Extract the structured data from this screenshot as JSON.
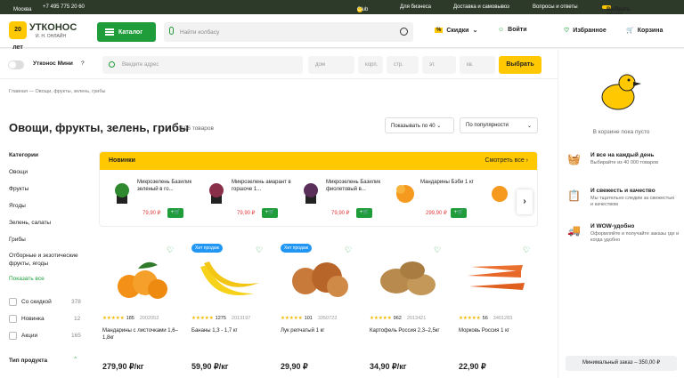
{
  "topbar": {
    "city": "Москва",
    "phone": "+7 495 775 20 60",
    "club": "Club",
    "business": "Для бизнеса",
    "delivery": "Доставка и самовывоз",
    "faq": "Вопросы и ответы",
    "choose_time": "Выбрать время"
  },
  "header": {
    "logo": "УТКОНОС",
    "logo_sub": "И. Н. ОНЛАЙН",
    "logo_badge": "20 лет",
    "catalog": "Каталог",
    "search_placeholder": "Найти колбасу",
    "discounts": "Скидки",
    "login": "Войти",
    "favorites": "Избранное",
    "cart": "Корзина"
  },
  "address": {
    "mini": "Утконос Мини",
    "help": "?",
    "placeholder": "Введите адрес",
    "house": "дом",
    "korp": "корп.",
    "str": "стр.",
    "floor": "эт.",
    "apt": "кв.",
    "choose": "Выбрать"
  },
  "breadcrumb": {
    "home": "Главная",
    "sep": "—",
    "current": "Овощи, фрукты, зелень, грибы"
  },
  "page": {
    "title": "Овощи, фрукты, зелень, грибы",
    "count": "1196 товаров",
    "show": "Показывать по 40",
    "sort": "По популярности"
  },
  "sidebar": {
    "categories_title": "Категории",
    "items": [
      "Овощи",
      "Фрукты",
      "Ягоды",
      "Зелень, салаты",
      "Грибы",
      "Отборные и экзотические фрукты, ягоды"
    ],
    "show_all": "Показать все",
    "filters": [
      {
        "label": "Со скидкой",
        "count": "378"
      },
      {
        "label": "Новинка",
        "count": "12"
      },
      {
        "label": "Акции",
        "count": "165"
      }
    ],
    "type_title": "Тип продукта"
  },
  "novelties": {
    "title": "Новинки",
    "see_all": "Смотреть все",
    "items": [
      {
        "name": "Микрозелень Базилик зеленый в го...",
        "price": "79,90 ₽"
      },
      {
        "name": "Микрозелень амарант в горшоче 1...",
        "price": "79,90 ₽"
      },
      {
        "name": "Микрозелень Базилик фиолетовый в...",
        "price": "79,90 ₽"
      },
      {
        "name": "Мандарины Бэби 1 кг",
        "price": "299,90 ₽"
      }
    ]
  },
  "products": [
    {
      "name": "Мандарины с листочками 1,6–1,8кг",
      "reviews": "185",
      "code": "2002053",
      "price": "279,90 ₽/кг",
      "hit": ""
    },
    {
      "name": "Бананы 1,3 - 1,7 кг",
      "reviews": "1275",
      "code": "2013197",
      "price": "59,90 ₽/кг",
      "hit": "Хит продаж"
    },
    {
      "name": "Лук репчатый 1 кг",
      "reviews": "101",
      "code": "3350723",
      "price": "29,90 ₽",
      "hit": "Хит продаж"
    },
    {
      "name": "Картофель Россия 2,3–2,5кг",
      "reviews": "962",
      "code": "2013421",
      "price": "34,90 ₽/кг",
      "hit": ""
    },
    {
      "name": "Морковь Россия 1 кг",
      "reviews": "56",
      "code": "3401283",
      "price": "22,90 ₽",
      "hit": ""
    }
  ],
  "cart": {
    "empty": "В корзине пока пусто",
    "features": [
      {
        "title": "И все на каждый день",
        "text": "Выбирайте из 40 000 товаров"
      },
      {
        "title": "И свежесть и качество",
        "text": "Мы тщательно следим за свежестью и качеством"
      },
      {
        "title": "И WOW-удобно",
        "text": "Оформляйте и получайте заказы где и когда удобно"
      }
    ],
    "min_order": "Минимальный заказ – 350,00 ₽"
  },
  "colors": {
    "green": "#1f9d3a",
    "yellow": "#ffc800",
    "dark": "#2d3a2a"
  }
}
